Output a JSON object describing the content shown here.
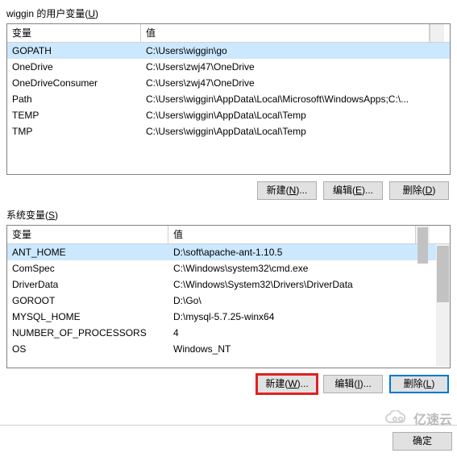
{
  "user_section": {
    "title_prefix": "wiggin 的用户变量(",
    "title_hotkey": "U",
    "title_suffix": ")",
    "columns": {
      "variable": "变量",
      "value": "值"
    },
    "rows": [
      {
        "name": "GOPATH",
        "value": "C:\\Users\\wiggin\\go"
      },
      {
        "name": "OneDrive",
        "value": "C:\\Users\\zwj47\\OneDrive"
      },
      {
        "name": "OneDriveConsumer",
        "value": "C:\\Users\\zwj47\\OneDrive"
      },
      {
        "name": "Path",
        "value": "C:\\Users\\wiggin\\AppData\\Local\\Microsoft\\WindowsApps;C:\\..."
      },
      {
        "name": "TEMP",
        "value": "C:\\Users\\wiggin\\AppData\\Local\\Temp"
      },
      {
        "name": "TMP",
        "value": "C:\\Users\\wiggin\\AppData\\Local\\Temp"
      }
    ],
    "selected_index": 0
  },
  "system_section": {
    "title_prefix": "系统变量(",
    "title_hotkey": "S",
    "title_suffix": ")",
    "columns": {
      "variable": "变量",
      "value": "值"
    },
    "rows": [
      {
        "name": "ANT_HOME",
        "value": "D:\\soft\\apache-ant-1.10.5"
      },
      {
        "name": "ComSpec",
        "value": "C:\\Windows\\system32\\cmd.exe"
      },
      {
        "name": "DriverData",
        "value": "C:\\Windows\\System32\\Drivers\\DriverData"
      },
      {
        "name": "GOROOT",
        "value": "D:\\Go\\"
      },
      {
        "name": "MYSQL_HOME",
        "value": "D:\\mysql-5.7.25-winx64"
      },
      {
        "name": "NUMBER_OF_PROCESSORS",
        "value": "4"
      },
      {
        "name": "OS",
        "value": "Windows_NT"
      }
    ],
    "selected_index": 0
  },
  "buttons": {
    "user_new_prefix": "新建(",
    "user_new_hot": "N",
    "user_new_suffix": ")...",
    "user_edit_prefix": "编辑(",
    "user_edit_hot": "E",
    "user_edit_suffix": ")...",
    "user_del_prefix": "删除(",
    "user_del_hot": "D",
    "user_del_suffix": ")",
    "sys_new_prefix": "新建(",
    "sys_new_hot": "W",
    "sys_new_suffix": ")...",
    "sys_edit_prefix": "编辑(",
    "sys_edit_hot": "I",
    "sys_edit_suffix": ")...",
    "sys_del_prefix": "删除(",
    "sys_del_hot": "L",
    "sys_del_suffix": ")",
    "ok": "确定"
  },
  "watermark": "亿速云"
}
